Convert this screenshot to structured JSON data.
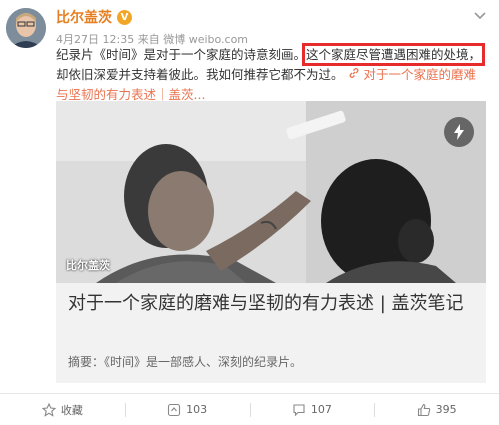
{
  "header": {
    "name": "比尔盖茨",
    "verified_badge": "V",
    "time": "4月27日 12:35",
    "source": "来自 微博 weibo.com"
  },
  "post": {
    "text_before": "纪录片《时间》是对于一个家庭的诗意刻画。",
    "highlight": "这个家庭尽管遭遇困难的处境，",
    "text_after": "却依旧深爱并支持着彼此。我如何推荐它都不为过。",
    "link_text": "对于一个家庭的磨难与坚韧的有力表述｜盖茨..."
  },
  "card": {
    "watermark": "比尔盖茨",
    "title": "对于一个家庭的磨难与坚韧的有力表述 | 盖茨笔记",
    "summary": "摘要：《时间》是一部感人、深刻的纪录片。"
  },
  "actions": {
    "favorite_label": "收藏",
    "repost_count": "103",
    "comment_count": "107",
    "like_count": "395"
  },
  "icons": {
    "more": "chevron-down-icon",
    "link": "link-icon",
    "flash": "lightning-icon",
    "favorite": "star-icon",
    "repost": "repost-icon",
    "comment": "comment-icon",
    "like": "thumbs-up-icon"
  },
  "colors": {
    "name": "#e67f22",
    "link": "#eb7350",
    "highlight_box": "#e52b2b"
  }
}
